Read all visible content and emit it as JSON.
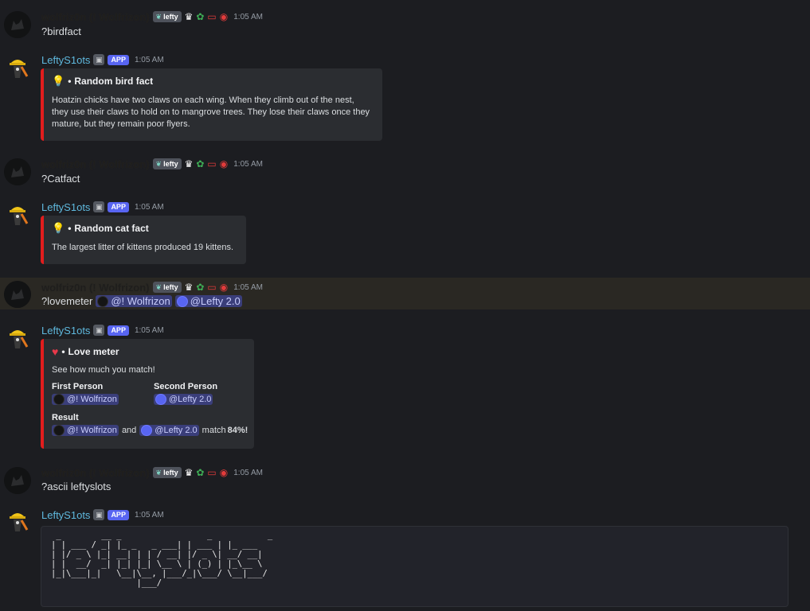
{
  "user": {
    "name": "wolfriz0n (! Wolfrizon)",
    "tag": "lefty",
    "tag_icon": "leaf-icon",
    "badges": [
      "crown-icon",
      "lotus-icon",
      "monitor-icon",
      "globe-icon"
    ]
  },
  "bot": {
    "name": "LeftyS1ots",
    "app_badge": "APP",
    "bot_icon": "robot-icon"
  },
  "messages": [
    {
      "author": "user",
      "time": "1:05 AM",
      "text": "?birdfact"
    },
    {
      "author": "bot",
      "time": "1:05 AM",
      "embed": {
        "icon": "lightbulb-icon",
        "title": "Random bird fact",
        "description": "Hoatzin chicks have two claws on each wing. When they climb out of the nest, they use their claws to hold on to mangrove trees. They lose their claws once they mature, but they remain poor flyers."
      }
    },
    {
      "author": "user",
      "time": "1:05 AM",
      "text": "?Catfact"
    },
    {
      "author": "bot",
      "time": "1:05 AM",
      "embed": {
        "icon": "lightbulb-icon",
        "title": "Random cat fact",
        "description": "The largest litter of kittens produced 19 kittens."
      }
    },
    {
      "author": "user",
      "time": "1:05 AM",
      "text": "?lovemeter",
      "mentions": [
        "@! Wolfrizon",
        "@Lefty 2.0"
      ]
    },
    {
      "author": "bot",
      "time": "1:05 AM",
      "embed": {
        "icon": "heart-icon",
        "title": "Love meter",
        "description": "See how much you match!",
        "fields": [
          {
            "name": "First Person",
            "value": "@! Wolfrizon"
          },
          {
            "name": "Second Person",
            "value": "@Lefty 2.0"
          },
          {
            "name": "Result",
            "mention1": "@! Wolfrizon",
            "and": "and",
            "mention2": "@Lefty 2.0",
            "match": "match",
            "percent": "84%!"
          }
        ]
      }
    },
    {
      "author": "user",
      "time": "1:05 AM",
      "text": "?ascii leftyslots"
    },
    {
      "author": "bot",
      "time": "1:05 AM",
      "ascii": " _        __ _                 _           _\n| | ___ / _| |_ _   _ ___| | ___ | |_ ___\n| |/ _ \\ |_| __| | | / __| |/ _ \\| __/ __|\n| |  __/  _| |_| |_| \\__ \\ | (_) | |_\\__ \\\n|_|\\___|_|   \\__|\\__, |___/_|\\___/ \\__|___/\n                 |___/"
    }
  ],
  "colors": {
    "background": "#1c1d21",
    "embed_border": "#e11d1d",
    "bot_name": "#5fb9de",
    "app_badge": "#5865f2",
    "highlight": "#2a2823"
  }
}
